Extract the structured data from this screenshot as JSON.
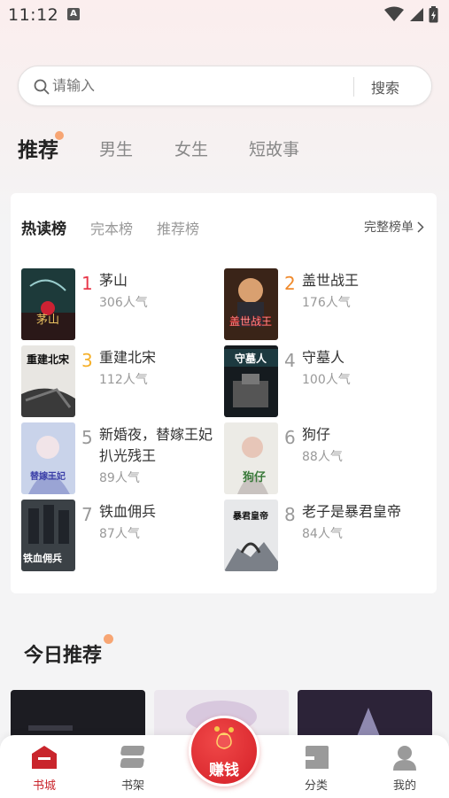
{
  "status_bar": {
    "time": "11:12",
    "notification_badge": "A"
  },
  "search": {
    "placeholder": "请输入",
    "button_label": "搜索"
  },
  "channel_tabs": [
    {
      "label": "推荐",
      "active": true
    },
    {
      "label": "男生",
      "active": false
    },
    {
      "label": "女生",
      "active": false
    },
    {
      "label": "短故事",
      "active": false
    }
  ],
  "rank_card": {
    "tabs": [
      "热读榜",
      "完本榜",
      "推荐榜"
    ],
    "active_tab": "热读榜",
    "full_list_label": "完整榜单",
    "books": [
      {
        "rank": "1",
        "title": "茅山",
        "popularity": "306人气",
        "cover_text": "茅山"
      },
      {
        "rank": "2",
        "title": "盖世战王",
        "popularity": "176人气",
        "cover_text": "盖世战王"
      },
      {
        "rank": "3",
        "title": "重建北宋",
        "popularity": "112人气",
        "cover_text": "重建北宋"
      },
      {
        "rank": "4",
        "title": "守墓人",
        "popularity": "100人气",
        "cover_text": "守墓人"
      },
      {
        "rank": "5",
        "title": "新婚夜，替嫁王妃扒光残王",
        "popularity": "89人气",
        "cover_text": "替嫁王妃"
      },
      {
        "rank": "6",
        "title": "狗仔",
        "popularity": "88人气",
        "cover_text": "狗仔"
      },
      {
        "rank": "7",
        "title": "铁血佣兵",
        "popularity": "87人气",
        "cover_text": "铁血佣兵"
      },
      {
        "rank": "8",
        "title": "老子是暴君皇帝",
        "popularity": "84人气",
        "cover_text": "暴君皇帝"
      }
    ],
    "rank_colors": {
      "1": "#e8384a",
      "2": "#f08a2c",
      "3": "#f5b02a",
      "other": "#999999"
    }
  },
  "today_section": {
    "title": "今日推荐"
  },
  "bottom_nav": {
    "items": [
      {
        "label": "书城",
        "icon": "bookstore-icon",
        "active": true
      },
      {
        "label": "书架",
        "icon": "bookshelf-icon",
        "active": false
      },
      {
        "label": "分类",
        "icon": "category-icon",
        "active": false
      },
      {
        "label": "我的",
        "icon": "profile-icon",
        "active": false
      }
    ],
    "earn_label": "赚钱"
  },
  "colors": {
    "accent": "#c9252c",
    "dot": "#f7a573"
  }
}
